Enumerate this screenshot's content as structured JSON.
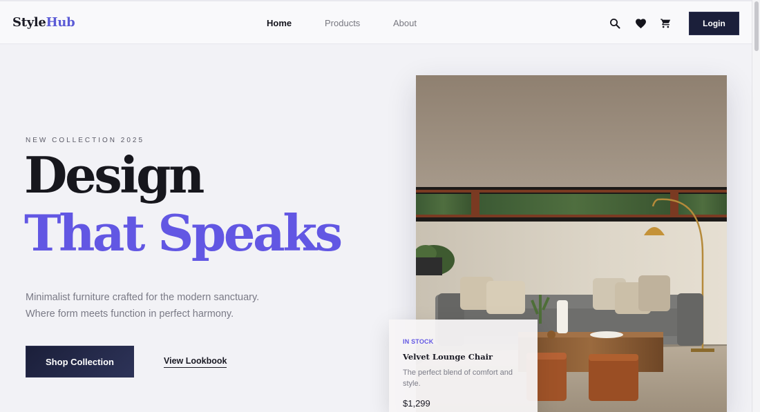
{
  "brand": {
    "part1": "Style",
    "part2": "Hub"
  },
  "nav": {
    "home": "Home",
    "products": "Products",
    "about": "About"
  },
  "header_icons": [
    "search-icon",
    "heart-icon",
    "cart-icon"
  ],
  "login_label": "Login",
  "hero": {
    "eyebrow": "NEW COLLECTION 2025",
    "headline_line1": "Design",
    "headline_line2": "That Speaks",
    "description_line1": "Minimalist furniture crafted for the modern sanctuary.",
    "description_line2": "Where form meets function in perfect harmony.",
    "primary_cta": "Shop Collection",
    "secondary_cta": "View Lookbook"
  },
  "product_card": {
    "badge": "IN STOCK",
    "title": "Velvet Lounge Chair",
    "description": "The perfect blend of comfort and style.",
    "price": "$1,299"
  },
  "colors": {
    "accent": "#6257e3",
    "dark": "#1b1f3a",
    "background": "#f2f2f6"
  }
}
